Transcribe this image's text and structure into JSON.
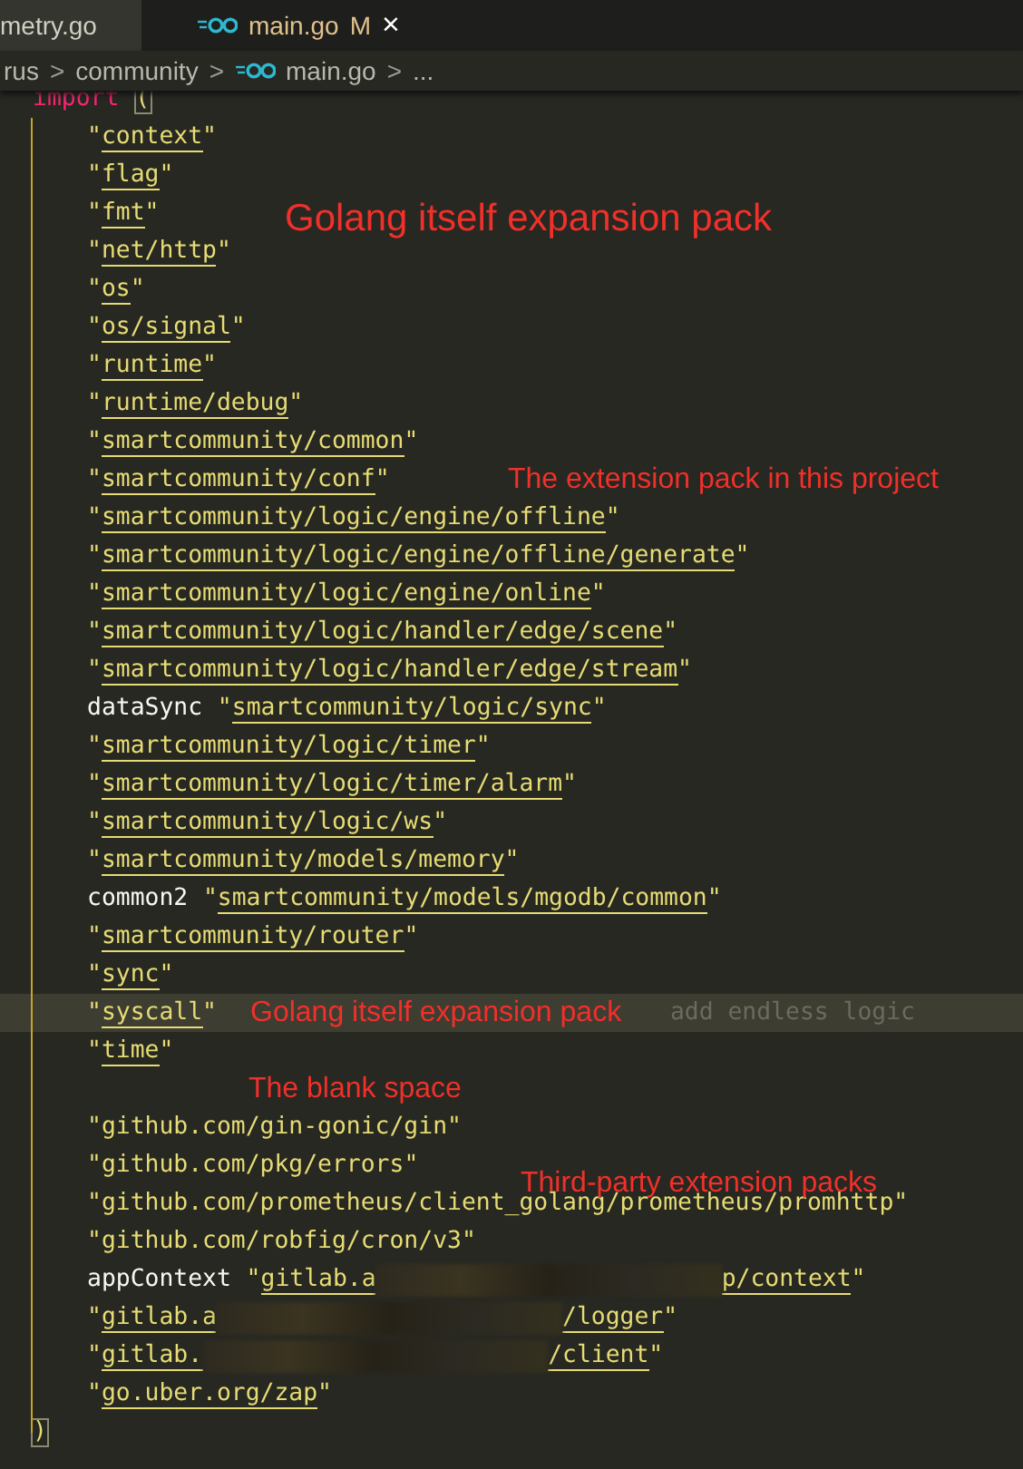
{
  "tabs": [
    {
      "label": "metry.go",
      "selected": false,
      "icon": false
    },
    {
      "label": "main.go",
      "selected": true,
      "icon": true,
      "badge": "M",
      "close": "×"
    }
  ],
  "breadcrumb": [
    {
      "label": "rus",
      "icon": false
    },
    {
      "label": "community",
      "icon": false
    },
    {
      "label": "main.go",
      "icon": true
    },
    {
      "label": "...",
      "icon": false
    }
  ],
  "breadcrumb_separator": ">",
  "code": {
    "keyword": "import",
    "open": "(",
    "close": ")",
    "quote": "\"",
    "lines": [
      {
        "kind": "import",
        "path": "context",
        "underlined": true,
        "current": false
      },
      {
        "kind": "import",
        "path": "flag",
        "underlined": true,
        "current": false
      },
      {
        "kind": "import",
        "path": "fmt",
        "underlined": true,
        "current": false
      },
      {
        "kind": "import",
        "path": "net/http",
        "underlined": true,
        "current": false
      },
      {
        "kind": "import",
        "path": "os",
        "underlined": true,
        "current": false
      },
      {
        "kind": "import",
        "path": "os/signal",
        "underlined": true,
        "current": false
      },
      {
        "kind": "import",
        "path": "runtime",
        "underlined": true,
        "current": false
      },
      {
        "kind": "import",
        "path": "runtime/debug",
        "underlined": true,
        "current": false
      },
      {
        "kind": "import",
        "path": "smartcommunity/common",
        "underlined": true,
        "current": false
      },
      {
        "kind": "import",
        "path": "smartcommunity/conf",
        "underlined": true,
        "current": false
      },
      {
        "kind": "import",
        "path": "smartcommunity/logic/engine/offline",
        "underlined": true,
        "current": false
      },
      {
        "kind": "import",
        "path": "smartcommunity/logic/engine/offline/generate",
        "underlined": true,
        "current": false
      },
      {
        "kind": "import",
        "path": "smartcommunity/logic/engine/online",
        "underlined": true,
        "current": false
      },
      {
        "kind": "import",
        "path": "smartcommunity/logic/handler/edge/scene",
        "underlined": true,
        "current": false
      },
      {
        "kind": "import",
        "path": "smartcommunity/logic/handler/edge/stream",
        "underlined": true,
        "current": false
      },
      {
        "kind": "import",
        "alias": "dataSync",
        "path": "smartcommunity/logic/sync",
        "underlined": true,
        "current": false
      },
      {
        "kind": "import",
        "path": "smartcommunity/logic/timer",
        "underlined": true,
        "current": false
      },
      {
        "kind": "import",
        "path": "smartcommunity/logic/timer/alarm",
        "underlined": true,
        "current": false
      },
      {
        "kind": "import",
        "path": "smartcommunity/logic/ws",
        "underlined": true,
        "current": false
      },
      {
        "kind": "import",
        "path": "smartcommunity/models/memory",
        "underlined": true,
        "current": false
      },
      {
        "kind": "import",
        "alias": "common2",
        "path": "smartcommunity/models/mgodb/common",
        "underlined": true,
        "current": false
      },
      {
        "kind": "import",
        "path": "smartcommunity/router",
        "underlined": true,
        "current": false
      },
      {
        "kind": "import",
        "path": "sync",
        "underlined": true,
        "current": false
      },
      {
        "kind": "import",
        "path": "syscall",
        "underlined": true,
        "current": true,
        "hint": "add endless logic"
      },
      {
        "kind": "import",
        "path": "time",
        "underlined": true,
        "current": false
      },
      {
        "kind": "blank"
      },
      {
        "kind": "import",
        "path": "github.com/gin-gonic/gin",
        "underlined": false,
        "current": false
      },
      {
        "kind": "import",
        "path": "github.com/pkg/errors",
        "underlined": false,
        "current": false
      },
      {
        "kind": "import",
        "path": "github.com/prometheus/client_golang/prometheus/promhttp",
        "underlined": false,
        "current": false
      },
      {
        "kind": "import",
        "path": "github.com/robfig/cron/v3",
        "underlined": false,
        "current": false
      },
      {
        "kind": "import",
        "alias": "appContext",
        "path": "gitlab.a",
        "path_end": "p/context",
        "underlined": true,
        "current": false
      },
      {
        "kind": "import",
        "path": "gitlab.a",
        "path_end": "/logger",
        "underlined": true,
        "current": false
      },
      {
        "kind": "import",
        "path": "gitlab.",
        "path_end": "/client",
        "underlined": true,
        "current": false
      },
      {
        "kind": "import",
        "path": "go.uber.org/zap",
        "underlined": true,
        "current": false
      }
    ]
  },
  "annotations": [
    {
      "text": "Golang itself expansion pack"
    },
    {
      "text": "The extension pack in this project"
    },
    {
      "text": "Golang itself expansion pack"
    },
    {
      "text": "The blank space"
    },
    {
      "text": "Third-party extension packs"
    }
  ]
}
